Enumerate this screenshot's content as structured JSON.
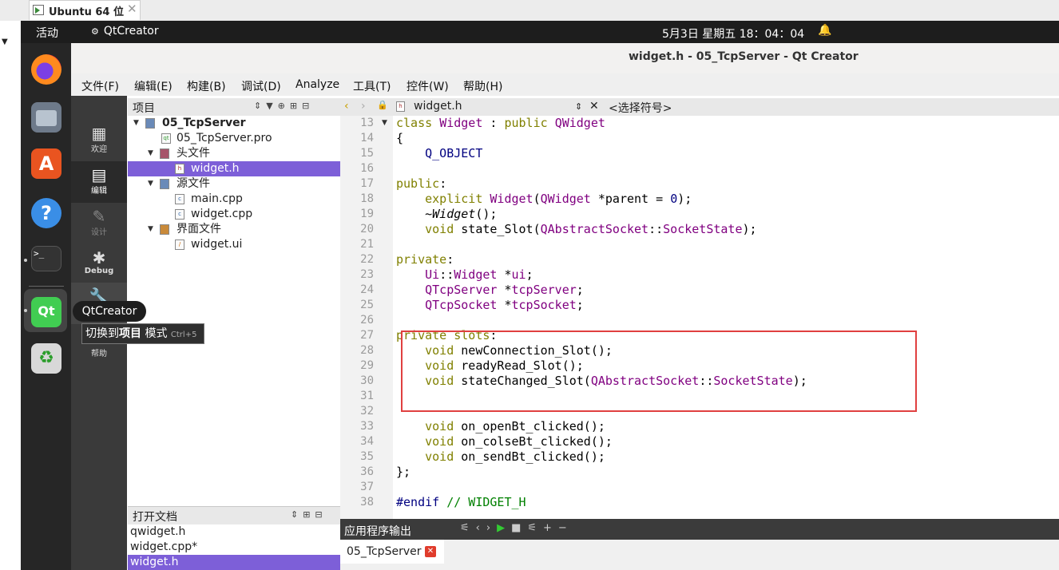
{
  "vm": {
    "tab_label": "Ubuntu 64 位",
    "close": "✕",
    "dropdown": "▼"
  },
  "topbar": {
    "activities": "活动",
    "app_name": "QtCreator",
    "clock": "5月3日 星期五  18：04：04",
    "bell": "🔔"
  },
  "window": {
    "title": "widget.h - 05_TcpServer - Qt Creator"
  },
  "menu": [
    "文件(F)",
    "编辑(E)",
    "构建(B)",
    "调试(D)",
    "Analyze",
    "工具(T)",
    "控件(W)",
    "帮助(H)"
  ],
  "modes": [
    {
      "icon": "▦",
      "label": "欢迎"
    },
    {
      "icon": "▤",
      "label": "编辑"
    },
    {
      "icon": "✎",
      "label": "设计"
    },
    {
      "icon": "✱",
      "label": "Debug"
    },
    {
      "icon": "?",
      "label": "帮助"
    }
  ],
  "project": {
    "header": "项目",
    "tree": [
      {
        "label": "05_TcpServer",
        "bold": true
      },
      {
        "label": "05_TcpServer.pro"
      },
      {
        "label": "头文件"
      },
      {
        "label": "widget.h",
        "selected": true
      },
      {
        "label": "源文件"
      },
      {
        "label": "main.cpp"
      },
      {
        "label": "widget.cpp"
      },
      {
        "label": "界面文件"
      },
      {
        "label": "widget.ui"
      }
    ]
  },
  "open_docs": {
    "header": "打开文档",
    "items": [
      {
        "label": "qwidget.h"
      },
      {
        "label": "widget.cpp*"
      },
      {
        "label": "widget.h",
        "selected": true
      }
    ]
  },
  "editor": {
    "file": "widget.h",
    "symbol": "<选择符号>",
    "lines": [
      {
        "n": "13",
        "code": "class Widget : public QWidget"
      },
      {
        "n": "14",
        "code": "{"
      },
      {
        "n": "15",
        "code": "    Q_OBJECT"
      },
      {
        "n": "16",
        "code": ""
      },
      {
        "n": "17",
        "code": "public:"
      },
      {
        "n": "18",
        "code": "    explicit Widget(QWidget *parent = 0);"
      },
      {
        "n": "19",
        "code": "    ~Widget();"
      },
      {
        "n": "20",
        "code": "    void state_Slot(QAbstractSocket::SocketState);"
      },
      {
        "n": "21",
        "code": ""
      },
      {
        "n": "22",
        "code": "private:"
      },
      {
        "n": "23",
        "code": "    Ui::Widget *ui;"
      },
      {
        "n": "24",
        "code": "    QTcpServer *tcpServer;"
      },
      {
        "n": "25",
        "code": "    QTcpSocket *tcpSocket;"
      },
      {
        "n": "26",
        "code": ""
      },
      {
        "n": "27",
        "code": "private slots:"
      },
      {
        "n": "28",
        "code": "    void newConnection_Slot();"
      },
      {
        "n": "29",
        "code": "    void readyRead_Slot();"
      },
      {
        "n": "30",
        "code": "    void stateChanged_Slot(QAbstractSocket::SocketState);"
      },
      {
        "n": "31",
        "code": ""
      },
      {
        "n": "32",
        "code": ""
      },
      {
        "n": "33",
        "code": "    void on_openBt_clicked();"
      },
      {
        "n": "34",
        "code": "    void on_colseBt_clicked();"
      },
      {
        "n": "35",
        "code": "    void on_sendBt_clicked();"
      },
      {
        "n": "36",
        "code": "};"
      },
      {
        "n": "37",
        "code": ""
      },
      {
        "n": "38",
        "code": "#endif // WIDGET_H"
      }
    ]
  },
  "output": {
    "header": "应用程序输出",
    "tab": "05_TcpServer"
  },
  "tooltip": {
    "app": "QtCreator",
    "prefix": "切换到",
    "bold": "项目",
    "suffix": " 模式",
    "shortcut": "Ctrl+5"
  }
}
